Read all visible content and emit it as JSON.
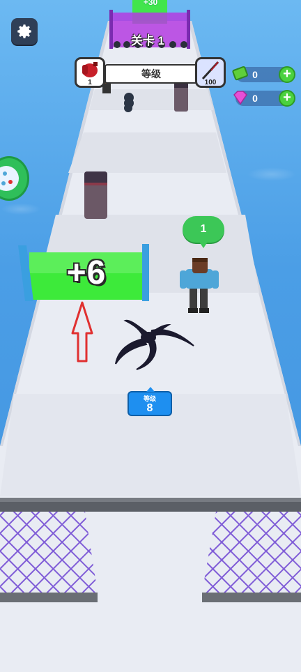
{
  "hud": {
    "stage_label": "关卡",
    "stage_number": "1",
    "level_bar_label": "等级",
    "left_item_count": "1",
    "right_item_count": "100",
    "cash_value": "0",
    "gem_value": "0",
    "plus_symbol": "+"
  },
  "track": {
    "top_gate_text": "+30",
    "gate_text": "+6",
    "ally_bubble_count": "1"
  },
  "player": {
    "level_label": "等级",
    "level_value": "8"
  },
  "icons": {
    "settings": "gear-icon",
    "left_item": "boxing-glove-icon",
    "right_item": "blade-weapon-icon",
    "cash": "cash-icon",
    "gem": "gem-icon"
  },
  "colors": {
    "water": "#4fa3e6",
    "track": "#e9ecf3",
    "gate_green": "#3dea3a",
    "gate_purple": "#b43ce0",
    "net_purple": "#7a55d6"
  }
}
